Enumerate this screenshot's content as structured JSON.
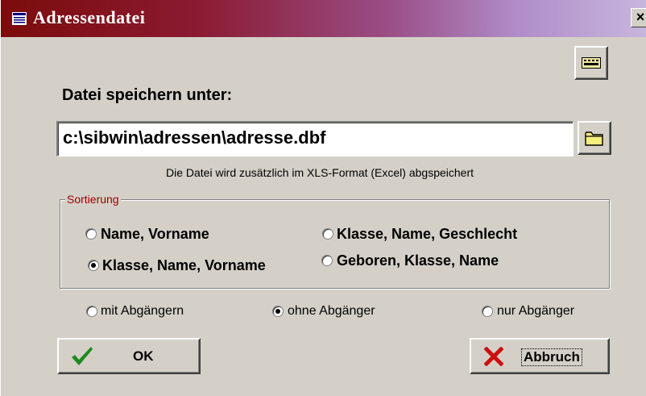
{
  "window": {
    "title": "Adressendatei",
    "close_label": "×"
  },
  "form": {
    "save_label": "Datei speichern unter:",
    "path_value": "c:\\sibwin\\adressen\\adresse.dbf",
    "note": "Die Datei wird zusätzlich im XLS-Format (Excel) abgspeichert"
  },
  "sorting": {
    "legend": "Sortierung",
    "options": [
      {
        "label": "Name, Vorname",
        "selected": false
      },
      {
        "label": "Klasse, Name, Geschlecht",
        "selected": false
      },
      {
        "label": "Klasse, Name, Vorname",
        "selected": true
      },
      {
        "label": "Geboren, Klasse, Name",
        "selected": false
      }
    ]
  },
  "filter": {
    "options": [
      {
        "label": "mit Abgängern",
        "selected": false
      },
      {
        "label": "ohne Abgänger",
        "selected": true
      },
      {
        "label": "nur Abgänger",
        "selected": false
      }
    ]
  },
  "buttons": {
    "ok": "OK",
    "cancel": "Abbruch"
  },
  "icons": {
    "title": "window-menu-icon",
    "small_button": "keyboard-icon",
    "browse": "folder-icon",
    "ok": "checkmark-icon",
    "cancel": "x-cross-icon"
  },
  "colors": {
    "legend": "#a00000",
    "check": "#1e8a1e",
    "cross": "#cc1010"
  }
}
